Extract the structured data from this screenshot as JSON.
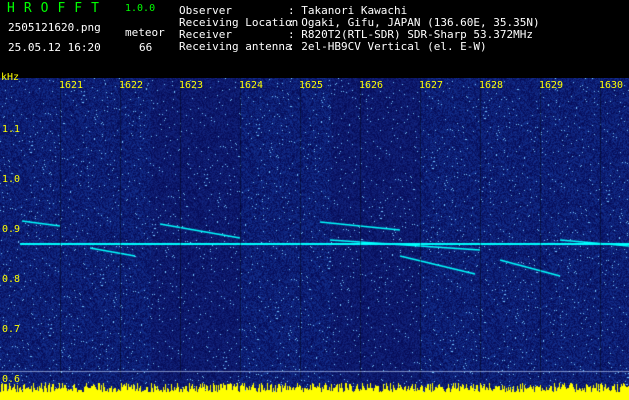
{
  "header": {
    "app_title": "HROFFT",
    "version": "1.0.0",
    "filename": "2505121620.png",
    "datetime": "25.05.12 16:20",
    "meteor_label": "meteor",
    "meteor_count": "66"
  },
  "info": [
    {
      "label": "Observer",
      "value": ": Takanori Kawachi"
    },
    {
      "label": "Receiving Location",
      "value": ": Ogaki, Gifu, JAPAN (136.60E, 35.35N)"
    },
    {
      "label": "Receiver",
      "value": ": R820T2(RTL-SDR) SDR-Sharp 53.372MHz"
    },
    {
      "label": "Receiving antenna",
      "value": ": 2el-HB9CV Vertical (el. E-W)"
    }
  ],
  "axis": {
    "unit": "kHz",
    "time_ticks": [
      "1621",
      "1622",
      "1623",
      "1624",
      "1625",
      "1626",
      "1627",
      "1628",
      "1629",
      "1630"
    ],
    "freq_ticks": [
      "1.1",
      "1.0",
      "0.9",
      "0.8",
      "0.7",
      "0.6"
    ]
  },
  "colors": {
    "background": "#000000",
    "title": "#00ff00",
    "axis_text": "#ffff00",
    "spectrum_base": "#0a1a8c",
    "signal": "#00ffff",
    "baseline_bar": "#ffff00"
  }
}
